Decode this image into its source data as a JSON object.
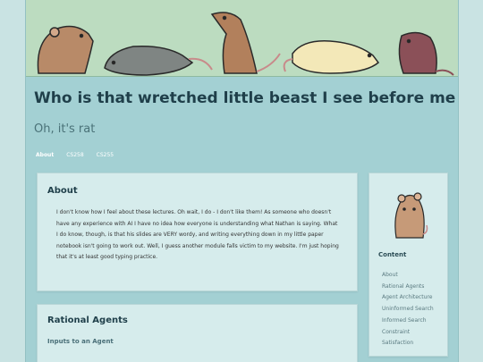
{
  "site": {
    "title": "Who is that wretched little beast I see before me",
    "subtitle": "Oh, it's rat"
  },
  "nav": {
    "items": [
      {
        "label": "About",
        "active": true
      },
      {
        "label": "CS258"
      },
      {
        "label": "CS255"
      }
    ]
  },
  "about": {
    "heading": "About",
    "text": "I don't know how I feel about these lectures. Oh wait, I do - I don't like them! As someone who doesn't have any experience with AI I have no idea how everyone is understanding what Nathan is saying. What I do know, though, is that his slides are VERY wordy, and writing everything down in my little paper notebook isn't going to work out. Well, I guess another module falls victim to my website. I'm just hoping that it's at least good typing practice."
  },
  "rational_agents": {
    "heading": "Rational Agents",
    "subheading": "Inputs to an Agent"
  },
  "sidebar": {
    "heading": "Content",
    "items": [
      {
        "label": "About"
      },
      {
        "label": "Rational Agents"
      },
      {
        "label": "Agent Architecture"
      },
      {
        "label": "Uninformed Search"
      },
      {
        "label": "Informed Search"
      },
      {
        "label": "Constraint"
      },
      {
        "label": "Satisfaction"
      }
    ]
  },
  "colors": {
    "background": "#c9e3e3",
    "frame": "#a3d0d3",
    "banner": "#bcdcc0",
    "card": "#d6ecec",
    "heading": "#1f3f4a"
  },
  "icons": [
    "rat-banner-illustration",
    "rat-avatar-icon"
  ]
}
